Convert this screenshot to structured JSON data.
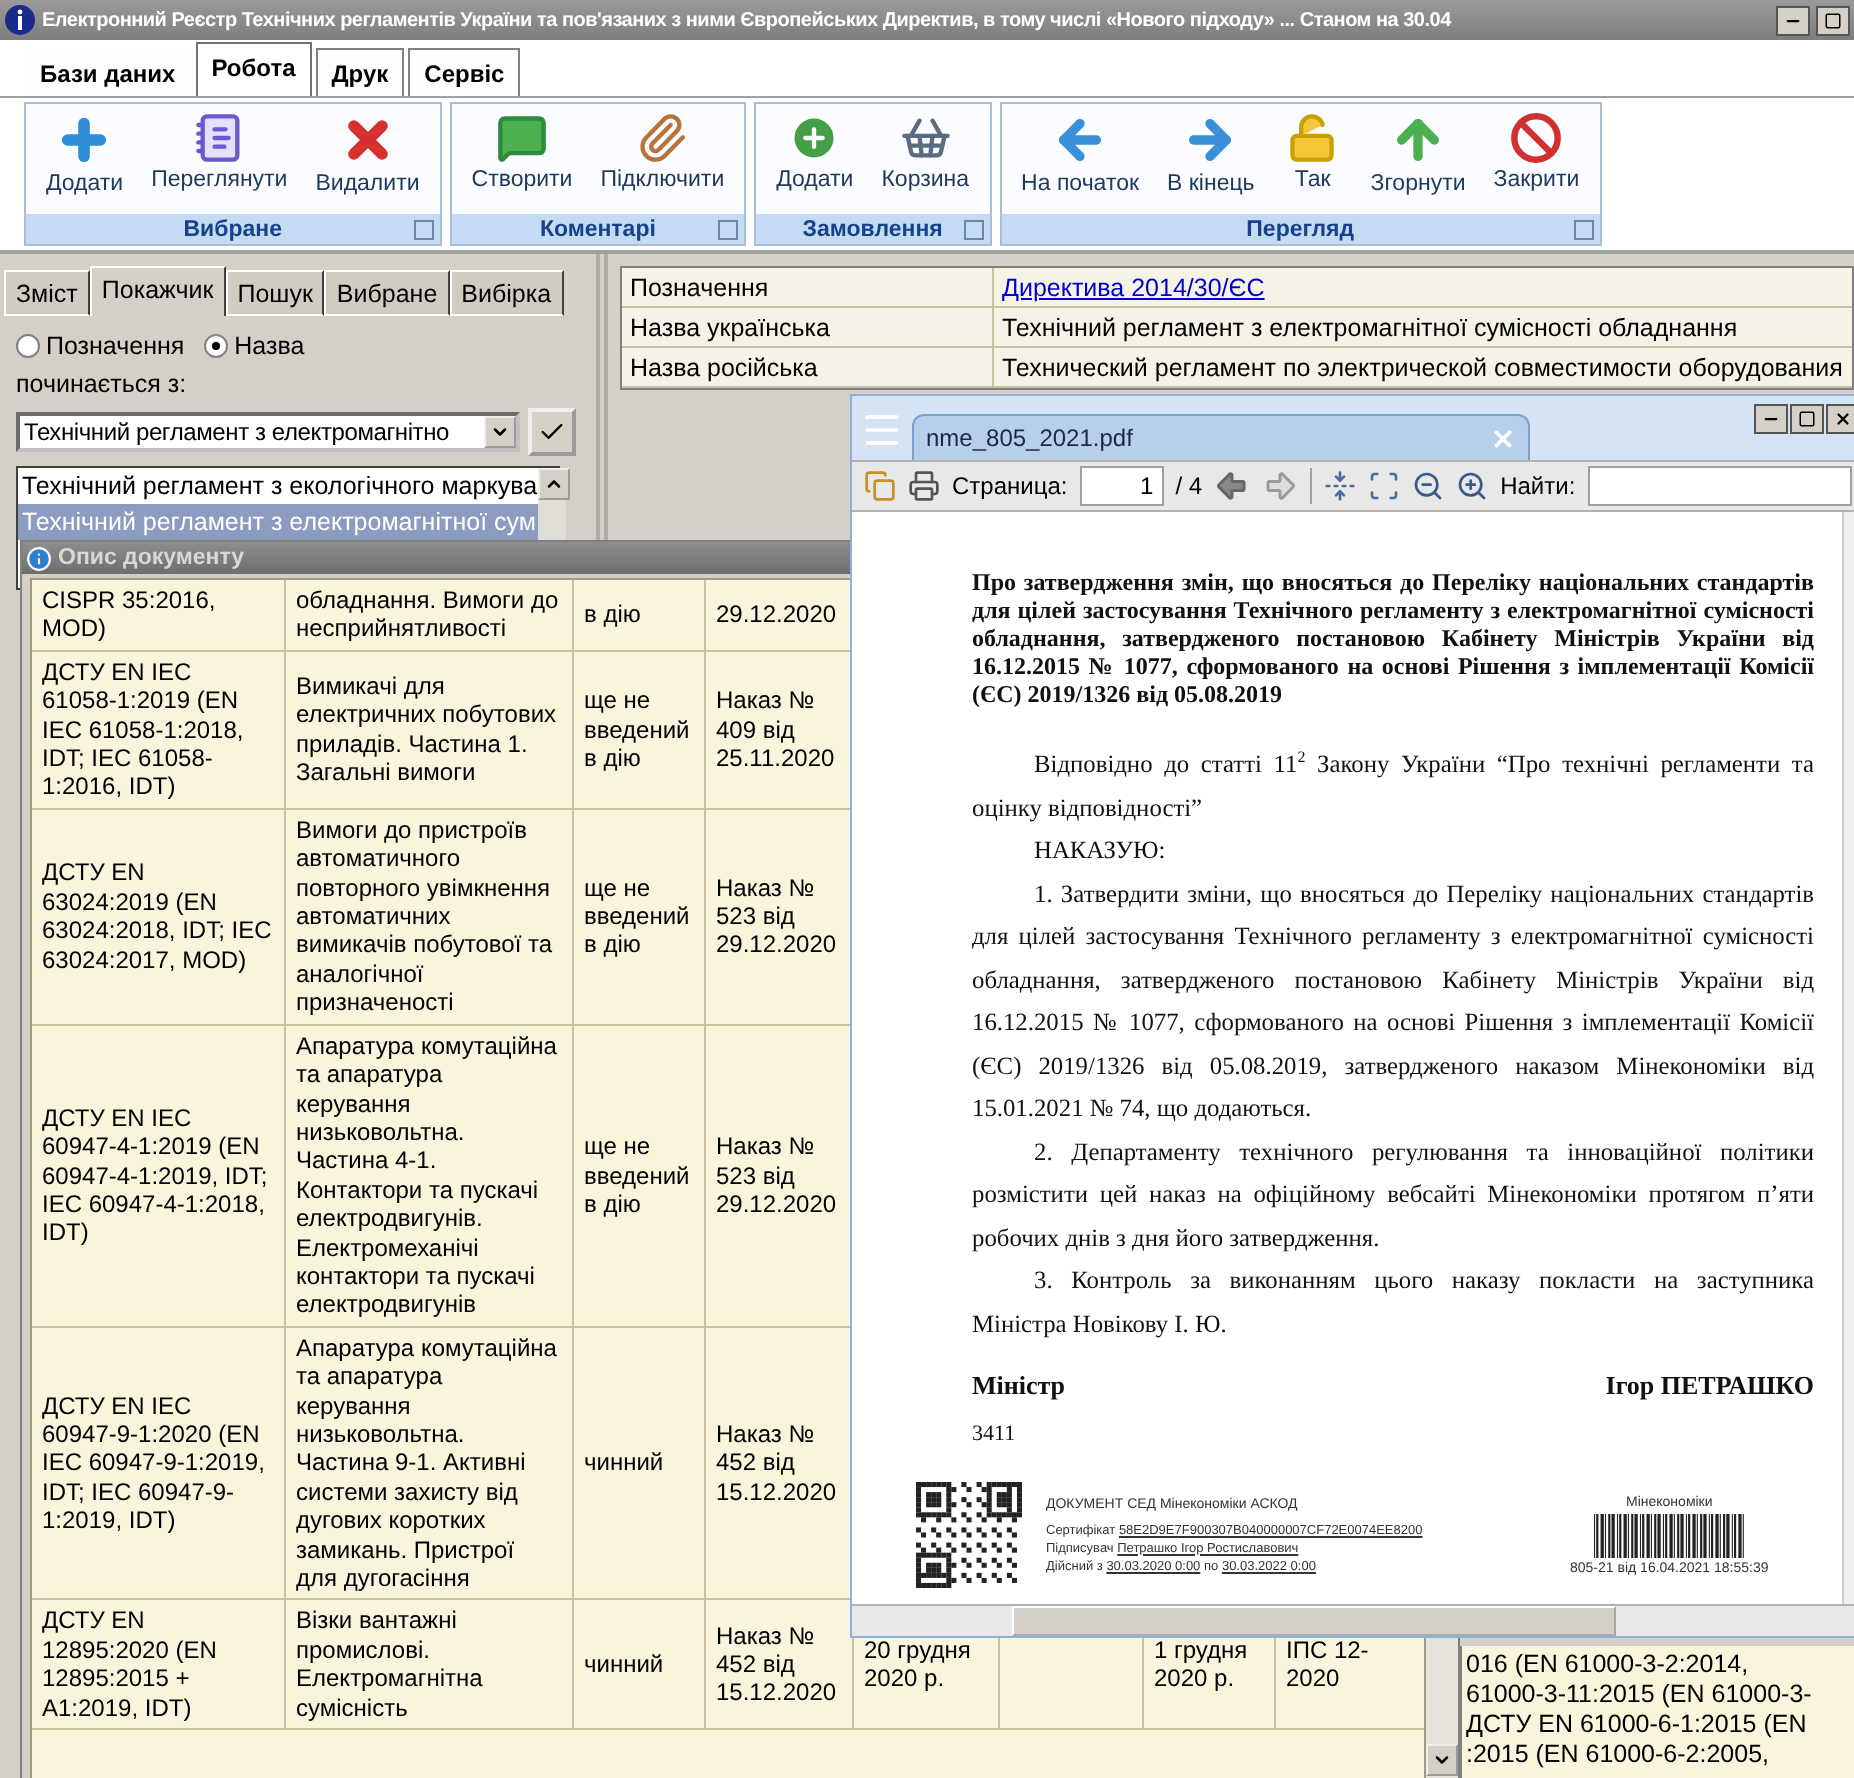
{
  "window": {
    "title": "Електронний Реєстр Технічних регламентів України та пов'язаних з ними Європейських Директив, в тому числі «Нового підходу» ... Станом на  30.04"
  },
  "menu_tabs": [
    {
      "label": "Бази даних",
      "selected": false
    },
    {
      "label": "Робота",
      "selected": true
    },
    {
      "label": "Друк",
      "selected": false
    },
    {
      "label": "Сервіс",
      "selected": false
    }
  ],
  "ribbon_groups": [
    {
      "label": "Вибране",
      "buttons": [
        "Додати",
        "Переглянути",
        "Видалити"
      ]
    },
    {
      "label": "Коментарі",
      "buttons": [
        "Створити",
        "Підключити"
      ]
    },
    {
      "label": "Замовлення",
      "buttons": [
        "Додати",
        "Корзина"
      ]
    },
    {
      "label": "Перегляд",
      "buttons": [
        "На початок",
        "В кінець",
        "Так",
        "Згорнути",
        "Закрити"
      ]
    }
  ],
  "side_tabs": [
    {
      "label": "Зміст",
      "selected": false
    },
    {
      "label": "Покажчик",
      "selected": true
    },
    {
      "label": "Пошук",
      "selected": false
    },
    {
      "label": "Вибране",
      "selected": false
    },
    {
      "label": "Вибірка",
      "selected": false
    }
  ],
  "search_by": [
    {
      "label": "Позначення",
      "selected": false
    },
    {
      "label": "Назва",
      "selected": true
    }
  ],
  "starts_with_label": "починається з:",
  "combo": {
    "value": "Технічний регламент з електромагнітно"
  },
  "list": [
    {
      "label": "Технічний регламент з екологічного маркува",
      "selected": false
    },
    {
      "label": "Технічний регламент з електромагнітної сум",
      "selected": true
    }
  ],
  "properties": [
    {
      "label": "Позначення",
      "value": "Директива 2014/30/ЄС",
      "kind": "link"
    },
    {
      "label": "Назва українська",
      "value": "Технічний регламент з електромагнітної сумісності обладнання",
      "kind": "text"
    },
    {
      "label": "Назва російська",
      "value": "Технический регламент по электрической совместимости оборудования",
      "kind": "text"
    }
  ],
  "detail_text": [
    "016 (EN 61000-3-2:2014,",
    "61000-3-11:2015 (EN 61000-3-",
    "ДСТУ EN 61000-6-1:2015 (EN",
    ":2015 (EN 61000-6-2:2005,"
  ],
  "description_window": {
    "title": "Опис документу",
    "rows": [
      [
        "CISPR 35:2016, MOD)",
        "обладнання. Вимоги до несприйнятливості",
        "в дію",
        "29.12.2020"
      ],
      [
        "ДСТУ EN IEC 61058-1:2019 (EN IEC 61058-1:2018, IDT; IEC 61058-1:2016, IDT)",
        "Вимикачі для електричних побутових приладів. Частина 1. Загальні вимоги",
        "ще не введений в дію",
        "Наказ № 409 від 25.11.2020"
      ],
      [
        "ДСТУ EN 63024:2019 (EN 63024:2018, IDT; IEC 63024:2017, MOD)",
        "Вимоги до пристроїв автоматичного повторного увімкнення автоматичних вимикачів побутової та аналогічної призначеності",
        "ще не введений в дію",
        "Наказ № 523 від 29.12.2020"
      ],
      [
        "ДСТУ EN IEC 60947-4-1:2019 (EN 60947-4-1:2019, IDT; IEC 60947-4-1:2018, IDT)",
        "Апаратура комутаційна та апаратура керування низьковольтна. Частина 4-1. Контактори та пускачі електродвигунів. Електромеханічі контактори та пускачі електродвигунів",
        "ще не введений в дію",
        "Наказ № 523 від 29.12.2020"
      ],
      [
        "ДСТУ EN IEC 60947-9-1:2020 (EN IEC 60947-9-1:2019, IDT; IEC 60947-9-1:2019, IDT)",
        "Апаратура комутаційна та апаратура керування низьковольтна. Частина 9-1. Активні системи захисту від дугових коротких замикань. Пристрої для дугогасіння",
        "чинний",
        "Наказ № 452 від 15.12.2020"
      ],
      [
        "ДСТУ EN 12895:2020 (EN 12895:2015 + A1:2019, IDT)",
        "Візки вантажні промислові. Електромагнітна сумісність",
        "чинний",
        "Наказ № 452 від 15.12.2020",
        "20 грудня 2020 р.",
        null,
        "1 грудня 2020 р.",
        "ІПС 12-2020"
      ]
    ]
  },
  "pdf_viewer": {
    "tab": "nme_805_2021.pdf",
    "page_label": "Страница:",
    "page": "1",
    "page_count": "/ 4",
    "find_label": "Найти:",
    "heading": "Про затвердження змін, що вносяться до Переліку національних стандартів для цілей застосування Технічного регламенту з електромагнітної сумісності обладнання, затвердженого постановою Кабінету Міністрів України від 16.12.2015 № 1077, сформованого на основі Рішення з імплементації Комісії (ЄС) 2019/1326 від 05.08.2019",
    "paragraphs": [
      "Відповідно до статті 11$^{2}$ Закону України “Про технічні регламенти та оцінку відповідності”",
      "НАКАЗУЮ:",
      "1. Затвердити зміни, що вносяться до Переліку національних стандартів для цілей застосування Технічного регламенту з електромагнітної сумісності обладнання, затвердженого постановою Кабінету Міністрів України від 16.12.2015 № 1077, сформованого на основі Рішення з імплементації Комісії (ЄС) 2019/1326 від 05.08.2019, затвердженого наказом Мінекономіки від 15.01.2021 № 74, що додаються.",
      "2. Департаменту технічного регулювання та інноваційної політики розмістити цей наказ на офіційному вебсайті Мінекономіки протягом п’яти робочих днів з дня його затвердження.",
      "3. Контроль за виконанням цього наказу покласти на заступника Міністра Новікову І. Ю."
    ],
    "signature": {
      "position": "Міністр",
      "name": "Ігор ПЕТРАШКО"
    },
    "number": "3411",
    "stamp": {
      "header": "ДОКУМЕНТ СЕД Мінекономіки  АСКОД",
      "certificate": {
        "label": "Сертифікат",
        "value": "58E2D9E7F900307B040000007CF72E0074EE8200"
      },
      "signer": {
        "label": "Підписувач",
        "value": "Петрашко Ігор Ростиславович"
      },
      "validity": {
        "label": "Дійсний з",
        "from": "30.03.2020 0:00",
        "between": "по",
        "to": "30.03.2022 0:00"
      }
    },
    "barcode": {
      "caption": "Мінекономіки",
      "number": "805-21 від 16.04.2021 18:55:39"
    }
  }
}
